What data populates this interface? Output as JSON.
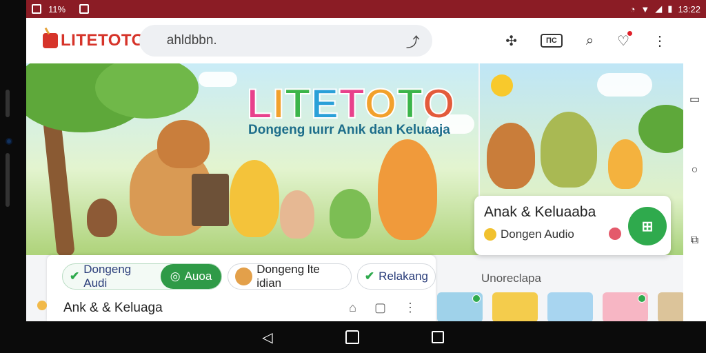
{
  "status_bar": {
    "left_text": "11%",
    "time": "13:22"
  },
  "app": {
    "logo": "LITETOTO",
    "search_text": "ahldbbn.",
    "icons": [
      "share-icon",
      "puzzle-icon",
      "cast-icon",
      "search-icon",
      "heart-icon",
      "more-icon"
    ]
  },
  "hero": {
    "title": "LITETOTO",
    "title_colors": [
      "#e8418c",
      "#f2a12c",
      "#3bb54a",
      "#2aa0d8",
      "#e8418c",
      "#f2a12c",
      "#3bb54a",
      "#e35b3b"
    ],
    "subtitle": "Dongeng ıuırr Anık dan Keluaaja"
  },
  "promo": {
    "title": "Anak & Keluaaba",
    "subtitle": "Dongen Audio",
    "button_label": "⊞"
  },
  "chips": {
    "chip1_label": "Dongeng Audi",
    "chip1_action": "Auoa",
    "chip2_label": "Dongeng lte idian",
    "chip3_label": "Relakang"
  },
  "card": {
    "title": "Ank & & Keluaga"
  },
  "shelf": {
    "title": "Unoreclapa"
  },
  "colors": {
    "status_bar": "#8b1c25",
    "accent_green": "#2faa4d"
  }
}
